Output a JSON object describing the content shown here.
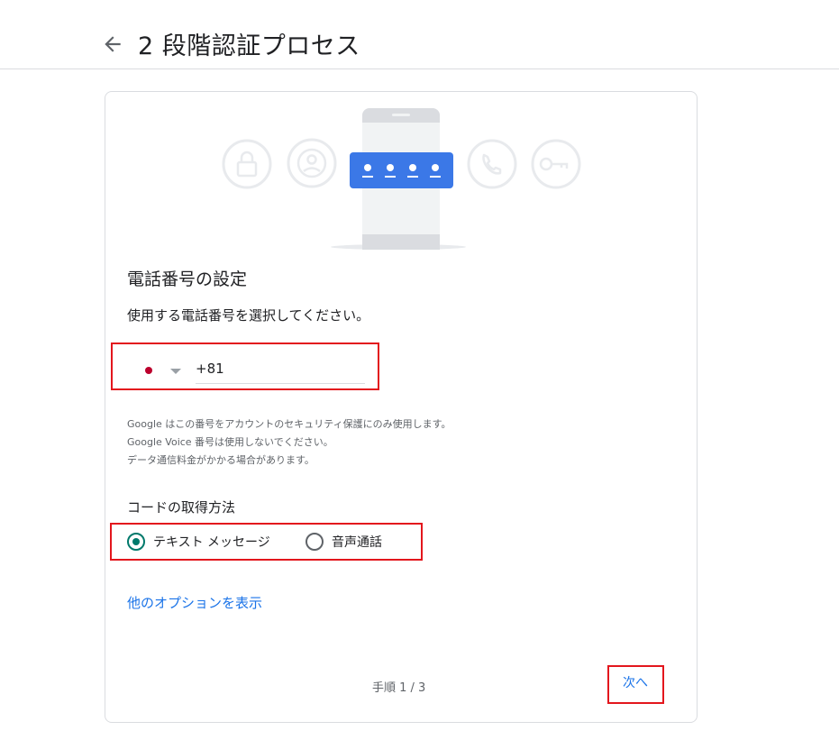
{
  "header": {
    "title": "2 段階認証プロセス",
    "back_icon": "arrow-left-icon"
  },
  "illustration": {
    "code_dots": [
      "●",
      "●",
      "●",
      "●"
    ],
    "icons": [
      "lock-icon",
      "account-icon",
      "phone-call-icon",
      "key-icon"
    ],
    "accent_color": "#4285f4"
  },
  "setup": {
    "section_title": "電話番号の設定",
    "instruction": "使用する電話番号を選択してください。",
    "country_flag": "jp-flag-icon",
    "phone_value": "+81",
    "notes": [
      "Google はこの番号をアカウントのセキュリティ保護にのみ使用します。",
      "Google Voice 番号は使用しないでください。",
      "データ通信料金がかかる場合があります。"
    ]
  },
  "method": {
    "title": "コードの取得方法",
    "options": [
      {
        "label": "テキスト メッセージ",
        "selected": true
      },
      {
        "label": "音声通話",
        "selected": false
      }
    ]
  },
  "links": {
    "more_options": "他のオプションを表示"
  },
  "footer": {
    "step": "手順 1 / 3",
    "next_label": "次へ"
  },
  "colors": {
    "highlight": "#e3161d",
    "link": "#1a73e8",
    "radio_selected": "#00796b"
  }
}
